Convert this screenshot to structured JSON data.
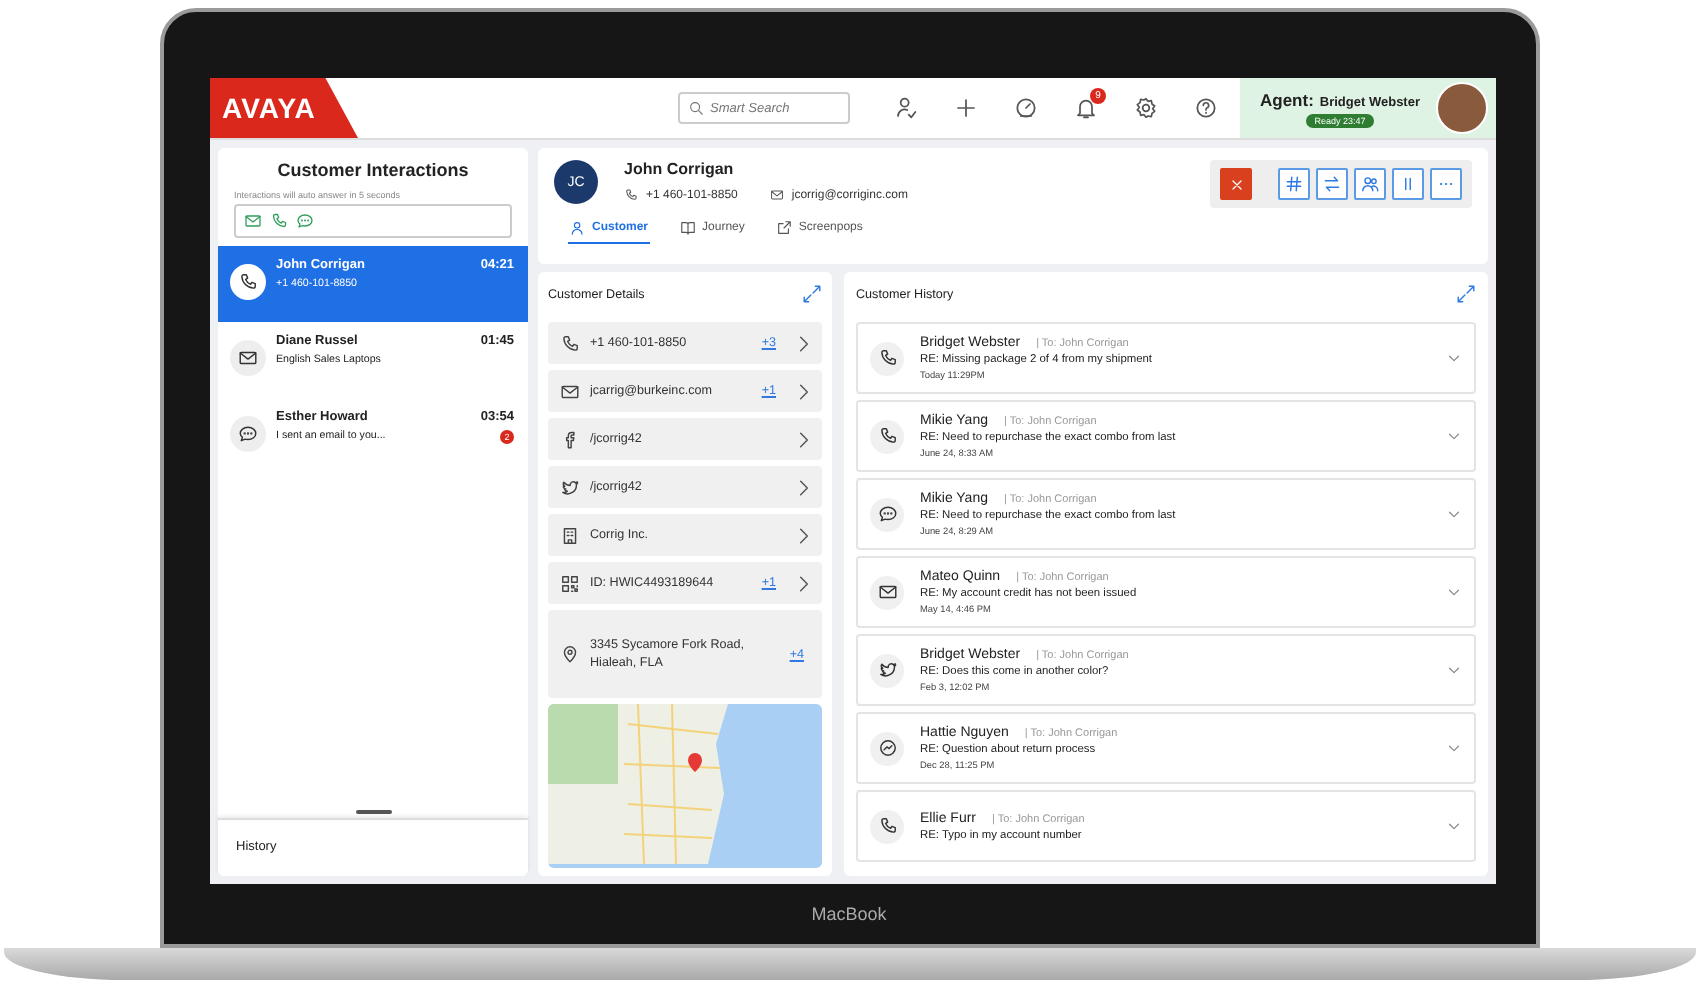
{
  "top_bar": {
    "logo": "AVAYA",
    "search": {
      "placeholder": "Smart Search"
    },
    "notifications": "9",
    "agent": {
      "label": "Agent:",
      "name": "Bridget Webster",
      "status": "Ready 23:47"
    }
  },
  "interactions_panel": {
    "title": "Customer Interactions",
    "note": "Interactions will auto answer in 5 seconds",
    "items": [
      {
        "kind": "call",
        "name": "John Corrigan",
        "detail": "+1 460-101-8850",
        "time": "04:21",
        "selected": true
      },
      {
        "kind": "email",
        "name": "Diane Russel",
        "detail": "English Sales Laptops",
        "time": "01:45",
        "selected": false
      },
      {
        "kind": "chat",
        "name": "Esther Howard",
        "detail": "I sent an email to you...",
        "time": "03:54",
        "unread": "2",
        "selected": false
      }
    ],
    "history_tab": "History"
  },
  "contact": {
    "initials": "JC",
    "name": "John Corrigan",
    "phone": "+1 460-101-8850",
    "email": "jcorrig@corriginc.com"
  },
  "tabs": [
    {
      "label": "Customer",
      "kind": "person",
      "selected": true
    },
    {
      "label": "Journey",
      "kind": "book",
      "selected": false
    },
    {
      "label": "Screenpops",
      "kind": "external",
      "selected": false
    }
  ],
  "customer_details": {
    "title": "Customer Details",
    "items": [
      {
        "kind": "phone",
        "text": "+1 460-101-8850",
        "more": "+3"
      },
      {
        "kind": "email",
        "text": "jcarrig@burkeinc.com",
        "more": "+1"
      },
      {
        "kind": "facebook",
        "text": "/jcorrig42"
      },
      {
        "kind": "twitter",
        "text": "/jcorrig42"
      },
      {
        "kind": "building",
        "text": "Corrig Inc."
      },
      {
        "kind": "qr",
        "text": "ID: HWIC4493189644",
        "more": "+1"
      }
    ],
    "address": {
      "text": "3345  Sycamore Fork Road, Hialeah, FLA",
      "more": "+4"
    }
  },
  "customer_history": {
    "title": "Customer History",
    "items": [
      {
        "kind": "phone",
        "from": "Bridget Webster",
        "to": "| To: John Corrigan",
        "subject": "RE: Missing package 2 of 4 from my shipment",
        "time": "Today 11:29PM"
      },
      {
        "kind": "phone",
        "from": "Mikie Yang",
        "to": "| To: John Corrigan",
        "subject": "RE: Need to repurchase the exact combo from last",
        "time": "June 24, 8:33 AM"
      },
      {
        "kind": "chat",
        "from": "Mikie Yang",
        "to": "| To: John Corrigan",
        "subject": "RE: Need to repurchase the exact combo from last",
        "time": "June 24, 8:29 AM"
      },
      {
        "kind": "email",
        "from": "Mateo Quinn",
        "to": "| To: John Corrigan",
        "subject": "RE: My account credit has not been issued",
        "time": "May 14, 4:46 PM"
      },
      {
        "kind": "twitter",
        "from": "Bridget Webster",
        "to": "| To: John Corrigan",
        "subject": "RE: Does this come in another color?",
        "time": "Feb 3, 12:02 PM"
      },
      {
        "kind": "messenger",
        "from": "Hattie Nguyen",
        "to": "| To: John Corrigan",
        "subject": "RE: Question about return process",
        "time": "Dec 28, 11:25 PM"
      },
      {
        "kind": "phone",
        "from": "Ellie Furr",
        "to": "| To: John Corrigan",
        "subject": "RE: Typo in my account number"
      }
    ]
  },
  "laptop": {
    "label": "MacBook"
  }
}
